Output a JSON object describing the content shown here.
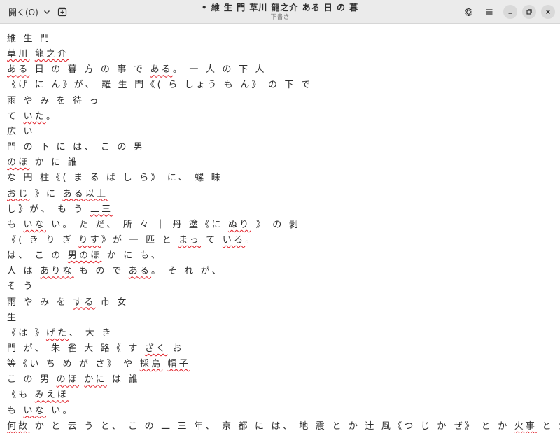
{
  "header": {
    "open_label": "開く(O)",
    "title": "• 維 生 門 草川 龍之介 ある 日 の 暮",
    "subtitle": "下書き",
    "icons": [
      "chevron-down-icon",
      "new-tab-icon",
      "settings-icon",
      "menu-icon",
      "minimize-icon",
      "maximize-icon",
      "close-icon"
    ]
  },
  "spell_underline_color": "#e01b24",
  "lines": [
    [
      {
        "t": "維 生 門"
      }
    ],
    [
      {
        "t": "草川",
        "s": true
      },
      {
        "t": " "
      },
      {
        "t": "龍之介",
        "s": true
      }
    ],
    [
      {
        "t": "ある",
        "s": true
      },
      {
        "t": " 日 の 暮 方 の 事 で "
      },
      {
        "t": "ある",
        "s": true
      },
      {
        "t": "。 一 人 の 下 人"
      }
    ],
    [
      {
        "t": "《げ に ん》が、 羅 生 門《( ら しょう も ん》 の 下 で"
      }
    ],
    [
      {
        "t": "雨 や み を 待 っ"
      }
    ],
    [
      {
        "t": "て "
      },
      {
        "t": "いた",
        "s": true
      },
      {
        "t": "。"
      }
    ],
    [
      {
        "t": "広 い"
      }
    ],
    [
      {
        "t": "門 の 下 に は、 こ の 男"
      }
    ],
    [
      {
        "t": "のほ",
        "s": true
      },
      {
        "t": " か に 誰"
      }
    ],
    [
      {
        "t": "な 円 柱《( ま る ば し ら》 に、 螺 昧"
      }
    ],
    [
      {
        "t": "おじ",
        "s": true
      },
      {
        "t": " 》に "
      },
      {
        "t": "ある以上",
        "s": true
      }
    ],
    [
      {
        "t": "し》が、 も う "
      },
      {
        "t": "二三",
        "s": true
      }
    ],
    [
      {
        "t": "も "
      },
      {
        "t": "いな",
        "s": true
      },
      {
        "t": " い。 た だ、 所 々 ｜ 丹 塗《に "
      },
      {
        "t": "ぬり",
        "s": true
      },
      {
        "t": " 》 の 剥"
      }
    ],
    [
      {
        "t": "《( き り ぎ "
      },
      {
        "t": "りす",
        "s": true
      },
      {
        "t": "》が 一 匹 と "
      },
      {
        "t": "まっ",
        "s": true
      },
      {
        "t": " て "
      },
      {
        "t": "いる",
        "s": true
      },
      {
        "t": "。"
      }
    ],
    [
      {
        "t": "は、 こ の "
      },
      {
        "t": "男のほ",
        "s": true
      },
      {
        "t": " か に も、"
      }
    ],
    [
      {
        "t": "人 は "
      },
      {
        "t": "ありな",
        "s": true
      },
      {
        "t": " も の で "
      },
      {
        "t": "ある",
        "s": true
      },
      {
        "t": "。 そ れ が、"
      }
    ],
    [
      {
        "t": "そ う"
      }
    ],
    [
      {
        "t": "雨 や み を "
      },
      {
        "t": "する",
        "s": true
      },
      {
        "t": " 市 女"
      }
    ],
    [
      {
        "t": "生"
      }
    ],
    [
      {
        "t": "《は 》"
      },
      {
        "t": "げた",
        "s": true
      },
      {
        "t": "、 大 き"
      }
    ],
    [
      {
        "t": "門 が、 朱 雀 大 路《 す "
      },
      {
        "t": "ざく",
        "s": true
      },
      {
        "t": " お"
      }
    ],
    [
      {
        "t": "等《い ち め が さ》 や "
      },
      {
        "t": "採鳥",
        "s": true
      },
      {
        "t": " "
      },
      {
        "t": "帽子",
        "s": true
      }
    ],
    [
      {
        "t": "こ の 男 "
      },
      {
        "t": "のほ",
        "s": true
      },
      {
        "t": " "
      },
      {
        "t": "かに",
        "s": true
      },
      {
        "t": " は 誰"
      }
    ],
    [
      {
        "t": "《も "
      },
      {
        "t": "みえぼ",
        "s": true
      }
    ],
    [
      {
        "t": "も "
      },
      {
        "t": "いな",
        "s": true
      },
      {
        "t": " い。"
      }
    ],
    [
      {
        "t": "何故",
        "s": true
      },
      {
        "t": " か と 云 う と、 こ の 二 三 年、 京 都 に は、 地 震 と か 辻 風《つ じ か ぜ》 と か "
      },
      {
        "t": "火事",
        "s": true
      },
      {
        "t": " と か 鱗 伴 と か 云 う 災"
      }
    ]
  ]
}
